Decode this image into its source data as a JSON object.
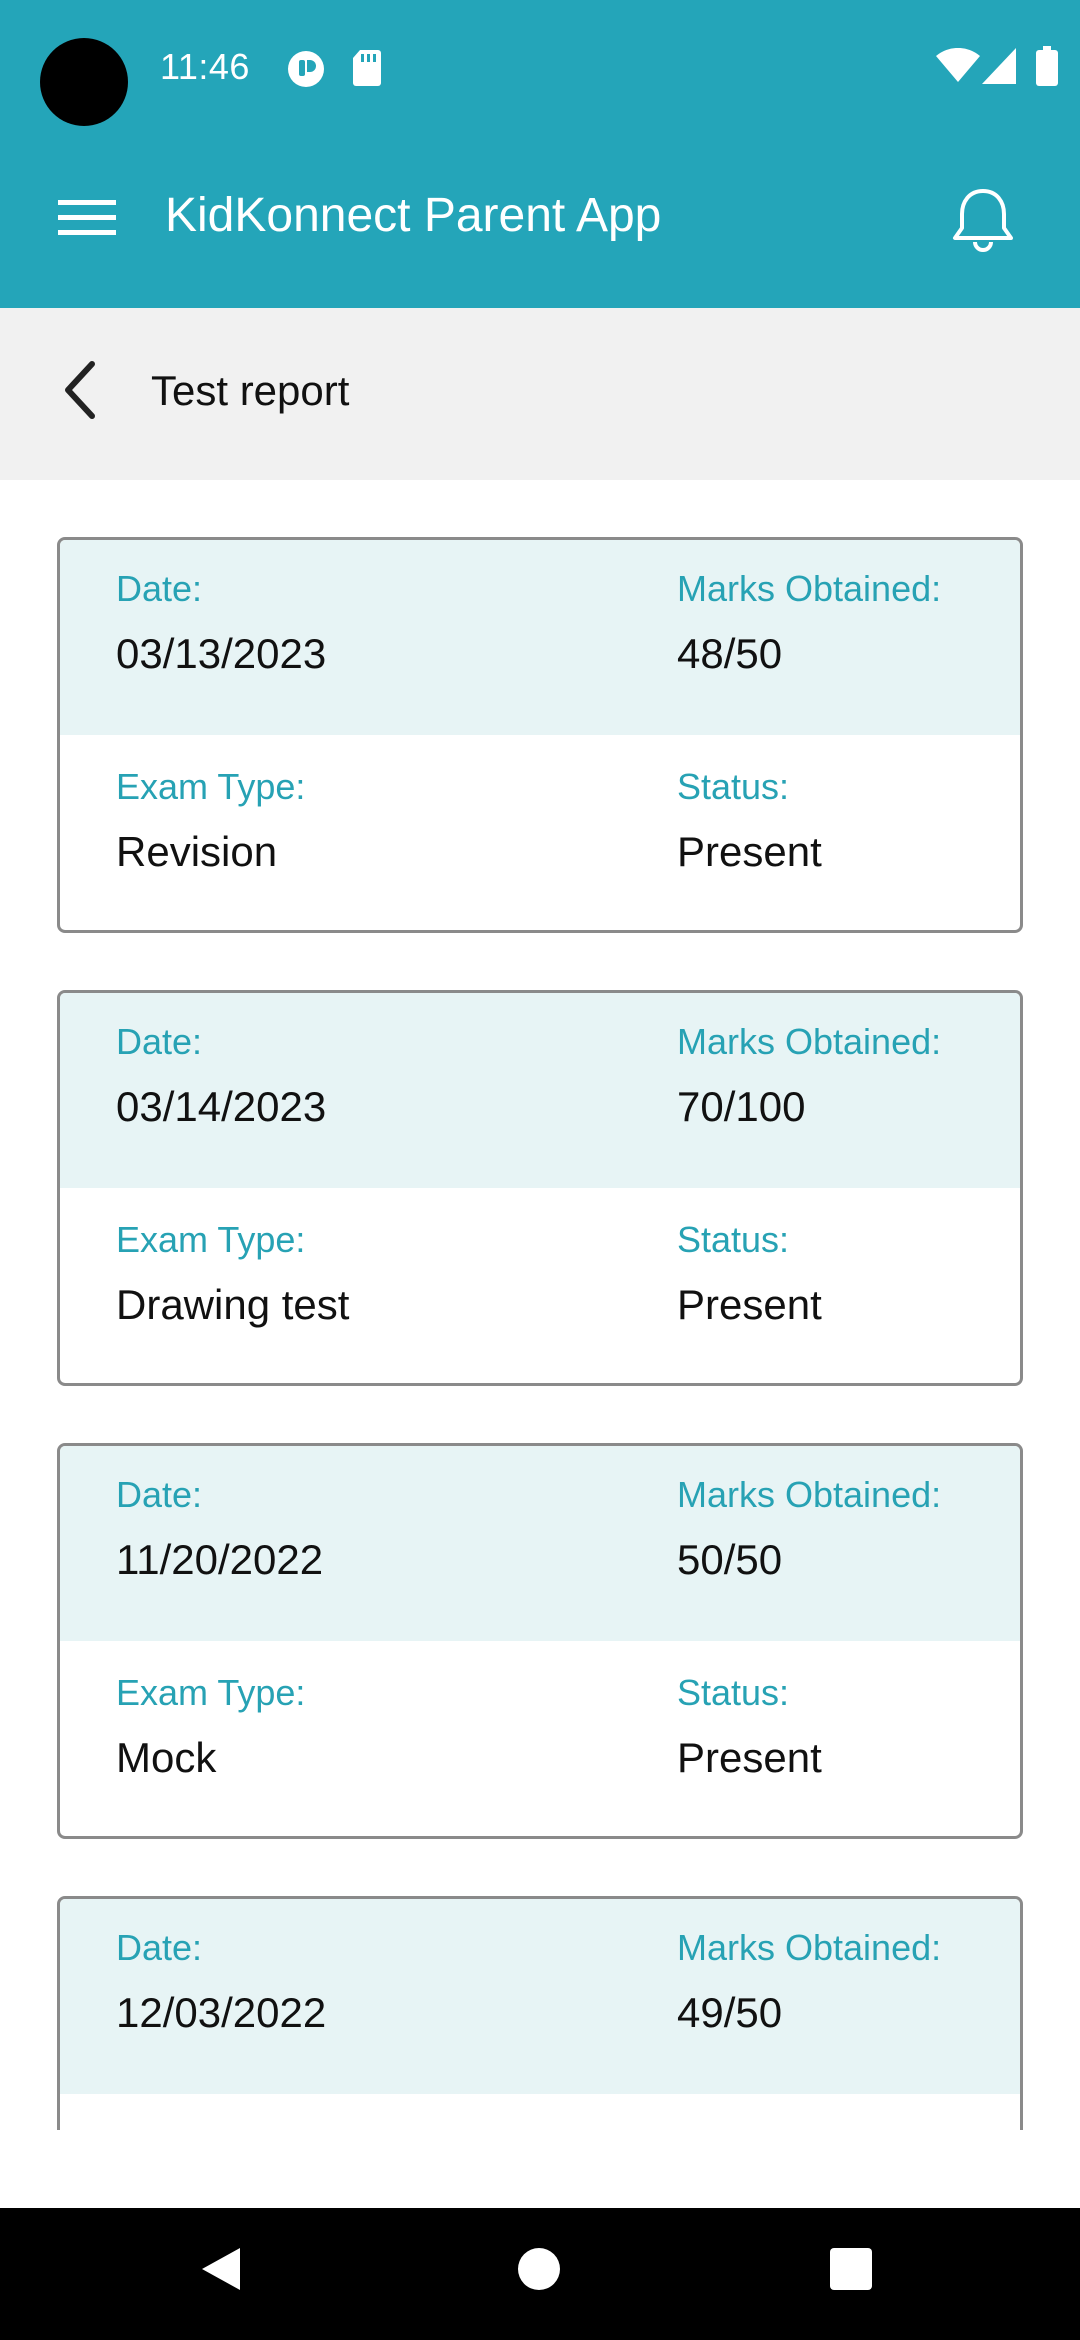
{
  "status_bar": {
    "time": "11:46",
    "icons": [
      "privacy-indicator-icon",
      "sd-card-icon",
      "wifi-icon",
      "signal-icon",
      "battery-icon"
    ]
  },
  "app_bar": {
    "title": "KidKonnect Parent App",
    "menu_icon": "hamburger-menu-icon",
    "notification_icon": "bell-icon"
  },
  "sub_header": {
    "title": "Test report",
    "back_icon": "chevron-left-icon"
  },
  "labels": {
    "date": "Date:",
    "marks": "Marks Obtained:",
    "exam_type": "Exam Type:",
    "status": "Status:"
  },
  "reports": [
    {
      "date": "03/13/2023",
      "marks": "48/50",
      "exam_type": "Revision",
      "status": "Present"
    },
    {
      "date": "03/14/2023",
      "marks": "70/100",
      "exam_type": "Drawing test",
      "status": "Present"
    },
    {
      "date": "11/20/2022",
      "marks": "50/50",
      "exam_type": "Mock",
      "status": "Present"
    },
    {
      "date": "12/03/2022",
      "marks": "49/50",
      "exam_type": "",
      "status": ""
    }
  ],
  "colors": {
    "primary": "#24a5b9",
    "label_accent": "#27a2b4",
    "card_header_bg": "#e7f4f5",
    "sub_header_bg": "#f1f1f1"
  },
  "nav_bar": {
    "icons": [
      "back-triangle-icon",
      "home-circle-icon",
      "recents-square-icon"
    ]
  }
}
